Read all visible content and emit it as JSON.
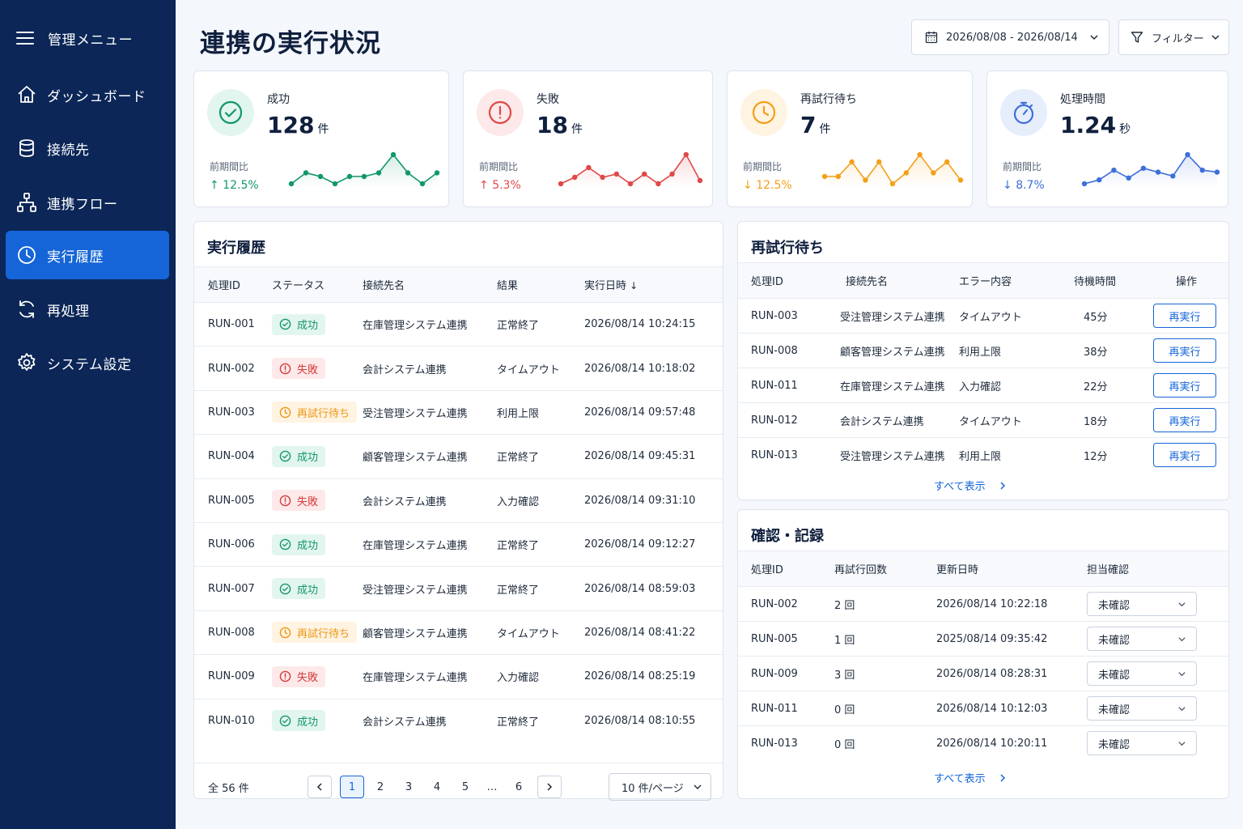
{
  "sidebar": {
    "menu_label": "管理メニュー",
    "items": [
      {
        "label": "ダッシュボード",
        "icon": "home-icon"
      },
      {
        "label": "接続先",
        "icon": "database-icon"
      },
      {
        "label": "連携フロー",
        "icon": "flow-icon"
      },
      {
        "label": "実行履歴",
        "icon": "clock-icon",
        "active": true
      },
      {
        "label": "再処理",
        "icon": "refresh-icon"
      },
      {
        "label": "システム設定",
        "icon": "gear-icon"
      }
    ]
  },
  "header": {
    "title": "連携の実行状況",
    "date_range": "2026/08/08 - 2026/08/14",
    "filter_label": "フィルター"
  },
  "kpis": [
    {
      "label": "成功",
      "value": "128",
      "unit": "件",
      "cmp_label": "前期間比",
      "cmp": "12.5%",
      "direction": "up",
      "color": "#11976d",
      "bg": "#e3f5ef",
      "icon": "check-circle-icon",
      "trend": [
        4,
        7,
        6,
        4,
        6,
        6,
        7,
        12,
        7,
        4,
        7
      ]
    },
    {
      "label": "失敗",
      "value": "18",
      "unit": "件",
      "cmp_label": "前期間比",
      "cmp": "5.3%",
      "direction": "up",
      "color": "#e04848",
      "bg": "#fde9e9",
      "icon": "alert-circle-icon",
      "trend": [
        4,
        6,
        9,
        6,
        7,
        4,
        7,
        4,
        7,
        13,
        5
      ]
    },
    {
      "label": "再試行待ち",
      "value": "7",
      "unit": "件",
      "cmp_label": "前期間比",
      "cmp": "12.5%",
      "direction": "down",
      "color": "#f2a019",
      "bg": "#fff3e2",
      "icon": "clock-icon",
      "trend": [
        6,
        6,
        10,
        5,
        10,
        4,
        7,
        12,
        7,
        10,
        5
      ]
    },
    {
      "label": "処理時間",
      "value": "1.24",
      "unit": "秒",
      "cmp_label": "前期間比",
      "cmp": "8.7%",
      "direction": "down",
      "color": "#3d6fd9",
      "bg": "#e6eefc",
      "icon": "stopwatch-icon",
      "trend": [
        3,
        5,
        10,
        6,
        11,
        9,
        7,
        18,
        10,
        9
      ]
    }
  ],
  "history": {
    "title": "実行履歴",
    "columns": [
      "処理ID",
      "ステータス",
      "接続先名",
      "結果",
      "実行日時"
    ],
    "rows": [
      {
        "id": "RUN-001",
        "status": "成功",
        "type": "success",
        "target": "在庫管理システム連携",
        "result": "正常終了",
        "time": "2026/08/14 10:24:15"
      },
      {
        "id": "RUN-002",
        "status": "失敗",
        "type": "fail",
        "target": "会計システム連携",
        "result": "タイムアウト",
        "time": "2026/08/14 10:18:02"
      },
      {
        "id": "RUN-003",
        "status": "再試行待ち",
        "type": "wait",
        "target": "受注管理システム連携",
        "result": "利用上限",
        "time": "2026/08/14 09:57:48"
      },
      {
        "id": "RUN-004",
        "status": "成功",
        "type": "success",
        "target": "顧客管理システム連携",
        "result": "正常終了",
        "time": "2026/08/14 09:45:31"
      },
      {
        "id": "RUN-005",
        "status": "失敗",
        "type": "fail",
        "target": "会計システム連携",
        "result": "入力確認",
        "time": "2026/08/14 09:31:10"
      },
      {
        "id": "RUN-006",
        "status": "成功",
        "type": "success",
        "target": "在庫管理システム連携",
        "result": "正常終了",
        "time": "2026/08/14 09:12:27"
      },
      {
        "id": "RUN-007",
        "status": "成功",
        "type": "success",
        "target": "受注管理システム連携",
        "result": "正常終了",
        "time": "2026/08/14 08:59:03"
      },
      {
        "id": "RUN-008",
        "status": "再試行待ち",
        "type": "wait",
        "target": "顧客管理システム連携",
        "result": "タイムアウト",
        "time": "2026/08/14 08:41:22"
      },
      {
        "id": "RUN-009",
        "status": "失敗",
        "type": "fail",
        "target": "在庫管理システム連携",
        "result": "入力確認",
        "time": "2026/08/14 08:25:19"
      },
      {
        "id": "RUN-010",
        "status": "成功",
        "type": "success",
        "target": "会計システム連携",
        "result": "正常終了",
        "time": "2026/08/14 08:10:55"
      }
    ],
    "total": "全 56 件",
    "pages": [
      "1",
      "2",
      "3",
      "4",
      "5",
      "…",
      "6"
    ],
    "current_page": "1",
    "per_page": "10 件/ページ"
  },
  "retry": {
    "title": "再試行待ち",
    "columns": [
      "処理ID",
      "接続先名",
      "エラー内容",
      "待機時間",
      "操作"
    ],
    "rows": [
      {
        "id": "RUN-003",
        "target": "受注管理システム連携",
        "error": "タイムアウト",
        "wait": "45分",
        "action": "再実行"
      },
      {
        "id": "RUN-008",
        "target": "顧客管理システム連携",
        "error": "利用上限",
        "wait": "38分",
        "action": "再実行"
      },
      {
        "id": "RUN-011",
        "target": "在庫管理システム連携",
        "error": "入力確認",
        "wait": "22分",
        "action": "再実行"
      },
      {
        "id": "RUN-012",
        "target": "会計システム連携",
        "error": "タイムアウト",
        "wait": "18分",
        "action": "再実行"
      },
      {
        "id": "RUN-013",
        "target": "受注管理システム連携",
        "error": "利用上限",
        "wait": "12分",
        "action": "再実行"
      }
    ],
    "show_all": "すべて表示"
  },
  "confirm": {
    "title": "確認・記録",
    "columns": [
      "処理ID",
      "再試行回数",
      "更新日時",
      "担当確認"
    ],
    "rows": [
      {
        "id": "RUN-002",
        "count": "2 回",
        "time": "2026/08/14 10:22:18",
        "status": "未確認"
      },
      {
        "id": "RUN-005",
        "count": "1 回",
        "time": "2025/08/14 09:35:42",
        "status": "未確認"
      },
      {
        "id": "RUN-009",
        "count": "3 回",
        "time": "2026/08/14 08:28:31",
        "status": "未確認"
      },
      {
        "id": "RUN-011",
        "count": "0 回",
        "time": "2026/08/14 10:12:03",
        "status": "未確認"
      },
      {
        "id": "RUN-013",
        "count": "0 回",
        "time": "2026/08/14 10:20:11",
        "status": "未確認"
      }
    ],
    "show_all": "すべて表示"
  }
}
